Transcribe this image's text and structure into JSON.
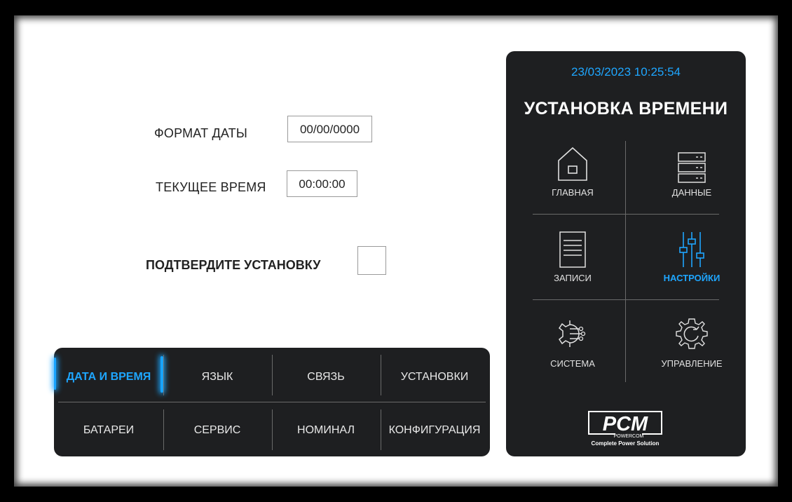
{
  "form": {
    "date_format_label": "ФОРМАТ ДАТЫ",
    "date_format_value": "00/00/0000",
    "current_time_label": "ТЕКУЩЕЕ ВРЕМЯ",
    "current_time_value": "00:00:00",
    "confirm_label": "ПОДТВЕРДИТЕ УСТАНОВКУ",
    "confirm_checked": false
  },
  "tabs": {
    "items": [
      {
        "label": "ДАТА И ВРЕМЯ",
        "active": true
      },
      {
        "label": "ЯЗЫК",
        "active": false
      },
      {
        "label": "СВЯЗЬ",
        "active": false
      },
      {
        "label": "УСТАНОВКИ",
        "active": false
      },
      {
        "label": "БАТАРЕИ",
        "active": false
      },
      {
        "label": "СЕРВИС",
        "active": false
      },
      {
        "label": "НОМИНАЛ",
        "active": false
      },
      {
        "label": "КОНФИГУРАЦИЯ",
        "active": false
      }
    ]
  },
  "side": {
    "datetime": "23/03/2023  10:25:54",
    "title": "УСТАНОВКА ВРЕМЕНИ",
    "nav": [
      {
        "label": "ГЛАВНАЯ",
        "icon": "home-icon",
        "active": false
      },
      {
        "label": "ДАННЫЕ",
        "icon": "data-server-icon",
        "active": false
      },
      {
        "label": "ЗАПИСИ",
        "icon": "document-icon",
        "active": false
      },
      {
        "label": "НАСТРОЙКИ",
        "icon": "sliders-icon",
        "active": true
      },
      {
        "label": "СИСТЕМА",
        "icon": "system-gear-icon",
        "active": false
      },
      {
        "label": "УПРАВЛЕНИЕ",
        "icon": "control-gear-icon",
        "active": false
      }
    ],
    "logo": {
      "brand": "PCM",
      "sub": "POWERCOM",
      "tagline": "Complete Power Solution"
    }
  },
  "colors": {
    "accent": "#1ea6ff",
    "panel": "#1e1f21",
    "background": "#ffffff",
    "frame": "#000000"
  }
}
